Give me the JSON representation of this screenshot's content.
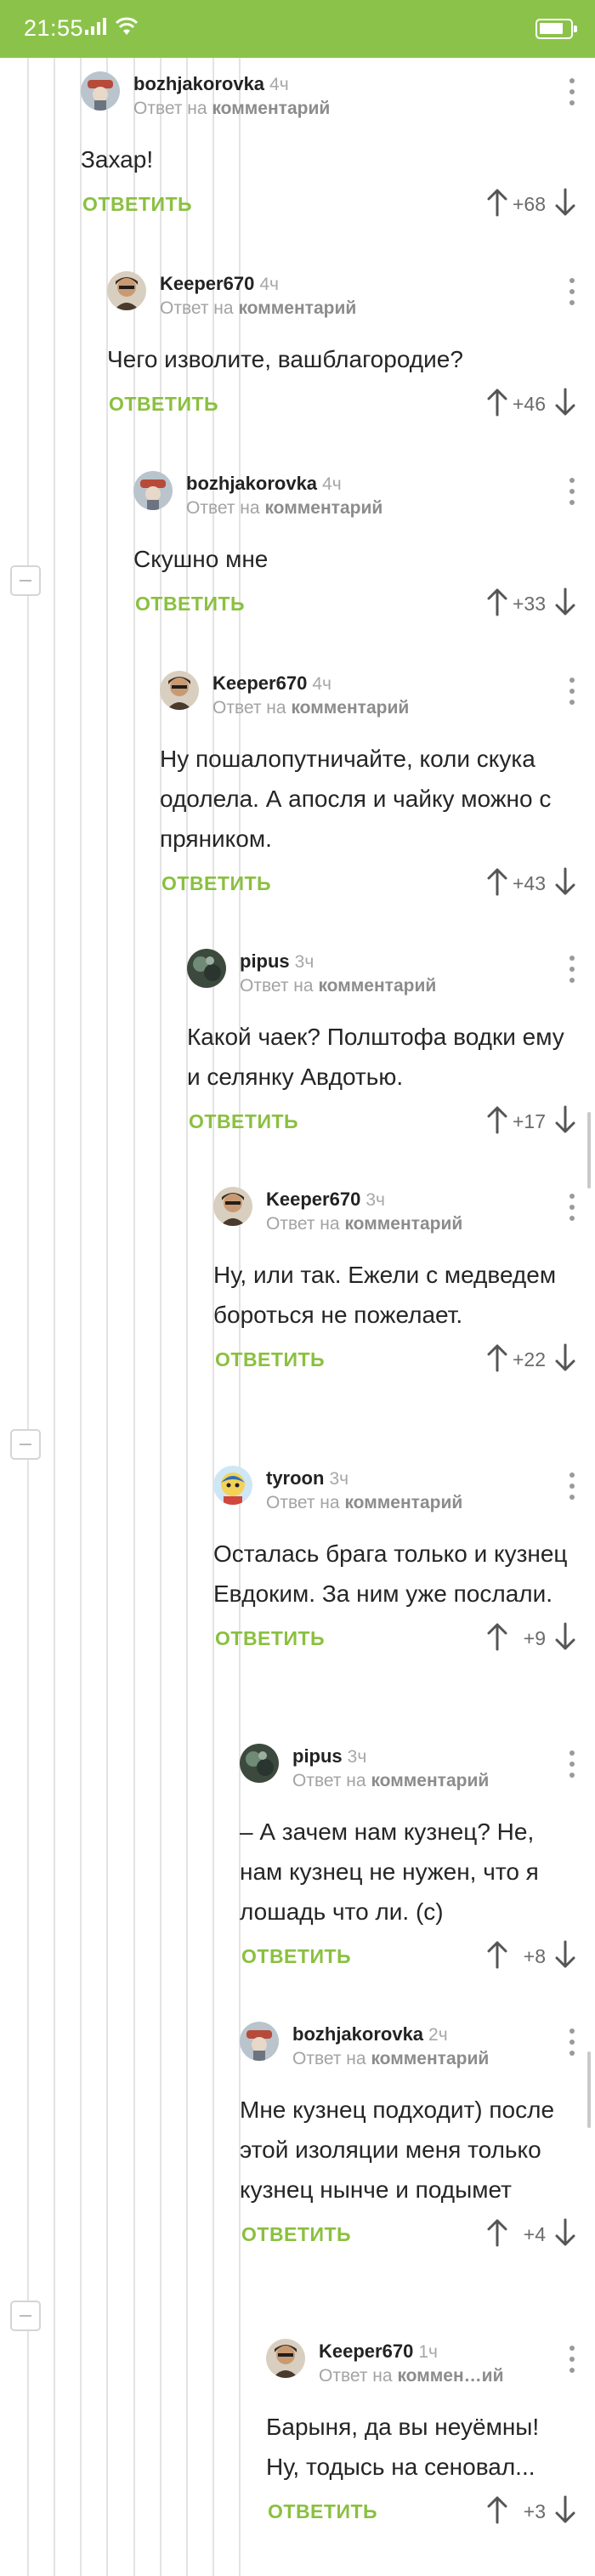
{
  "status_bar": {
    "time": "21:55",
    "icons": [
      "signal-icon",
      "wifi-icon",
      "battery-icon"
    ]
  },
  "reply_prefix": "Ответ на",
  "reply_target": "комментарий",
  "reply_label": "ОТВЕТИТЬ",
  "colors": {
    "status_bar": "#8bc34a",
    "reply": "#8ac03f",
    "thread_line": "#e3e3e3"
  },
  "comments": [
    {
      "author": "bozhjakorovka",
      "time": "4ч",
      "reply_to": "комментарий",
      "text": "Захар!",
      "rating": "+68",
      "avatar": "bozhjakorovka-avatar"
    },
    {
      "author": "Keeper670",
      "time": "4ч",
      "reply_to": "комментарий",
      "text": "Чего изволите, вашблагородие?",
      "rating": "+46",
      "avatar": "keeper670-avatar"
    },
    {
      "author": "bozhjakorovka",
      "time": "4ч",
      "reply_to": "комментарий",
      "text": "Скушно мне",
      "rating": "+33",
      "avatar": "bozhjakorovka-avatar"
    },
    {
      "author": "Keeper670",
      "time": "4ч",
      "reply_to": "комментарий",
      "text": "Ну пошалопутничайте, коли скука одолела. А апосля и чайку можно с пряником.",
      "rating": "+43",
      "avatar": "keeper670-avatar"
    },
    {
      "author": "pipus",
      "time": "3ч",
      "reply_to": "комментарий",
      "text": "Какой чаек? Полштофа водки ему и селянку Авдотью.",
      "rating": "+17",
      "avatar": "pipus-avatar"
    },
    {
      "author": "Keeper670",
      "time": "3ч",
      "reply_to": "комментарий",
      "text": "Ну, или так. Ежели с медведем бороться не пожелает.",
      "rating": "+22",
      "avatar": "keeper670-avatar"
    },
    {
      "author": "tyroon",
      "time": "3ч",
      "reply_to": "комментарий",
      "text": "Осталась брага только и кузнец Евдоким. За ним уже послали.",
      "rating": "+9",
      "avatar": "tyroon-avatar"
    },
    {
      "author": "pipus",
      "time": "3ч",
      "reply_to": "комментарий",
      "text": "– А зачем нам кузнец? Не, нам кузнец не нужен, что я лошадь что ли. (с)",
      "rating": "+8",
      "avatar": "pipus-avatar"
    },
    {
      "author": "bozhjakorovka",
      "time": "2ч",
      "reply_to": "комментарий",
      "text": "Мне кузнец подходит) после этой изоляции меня только кузнец нынче и подымет",
      "rating": "+4",
      "avatar": "bozhjakorovka-avatar"
    },
    {
      "author": "Keeper670",
      "time": "1ч",
      "reply_to": "коммен…ий",
      "text": "Барыня, да вы неуёмны! Ну, тодысь на сеновал...",
      "rating": "+3",
      "avatar": "keeper670-avatar"
    }
  ]
}
